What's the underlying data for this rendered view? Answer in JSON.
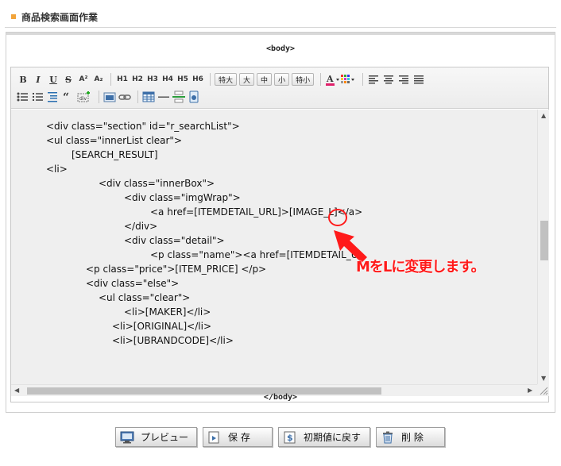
{
  "page": {
    "title": "商品検索画面作業"
  },
  "editor": {
    "top_tag": "<body>",
    "bottom_tag": "</body>",
    "toolbar": {
      "format_buttons": [
        "B",
        "I",
        "U",
        "S",
        "A²",
        "A₂"
      ],
      "heading_buttons": [
        "H1",
        "H2",
        "H3",
        "H4",
        "H5",
        "H6"
      ],
      "size_buttons": [
        "特大",
        "大",
        "中",
        "小",
        "特小"
      ]
    },
    "code_lines": [
      "<div class=\"section\" id=\"r_searchList\">",
      "<ul class=\"innerList clear\">",
      "[SEARCH_RESULT]",
      "<li>",
      "<div class=\"innerBox\">",
      "<div class=\"imgWrap\">",
      "<a href=[ITEMDETAIL_URL]>[IMAGE_L]</a>",
      "</div>",
      "<div class=\"detail\">",
      "<p class=\"name\"><a href=[ITEMDETAIL_U",
      "<p class=\"price\">[ITEM_PRICE] </p>",
      "<div class=\"else\">",
      "<ul class=\"clear\">",
      "<li>[MAKER]</li>",
      "<li>[ORIGINAL]</li>",
      "<li>[UBRANDCODE]</li>"
    ]
  },
  "annotation": {
    "text": "MをLに変更します。",
    "color": "#ff1a1a"
  },
  "buttons": {
    "preview": "プレビュー",
    "save": "保 存",
    "reset": "初期値に戻す",
    "delete": "削 除"
  }
}
